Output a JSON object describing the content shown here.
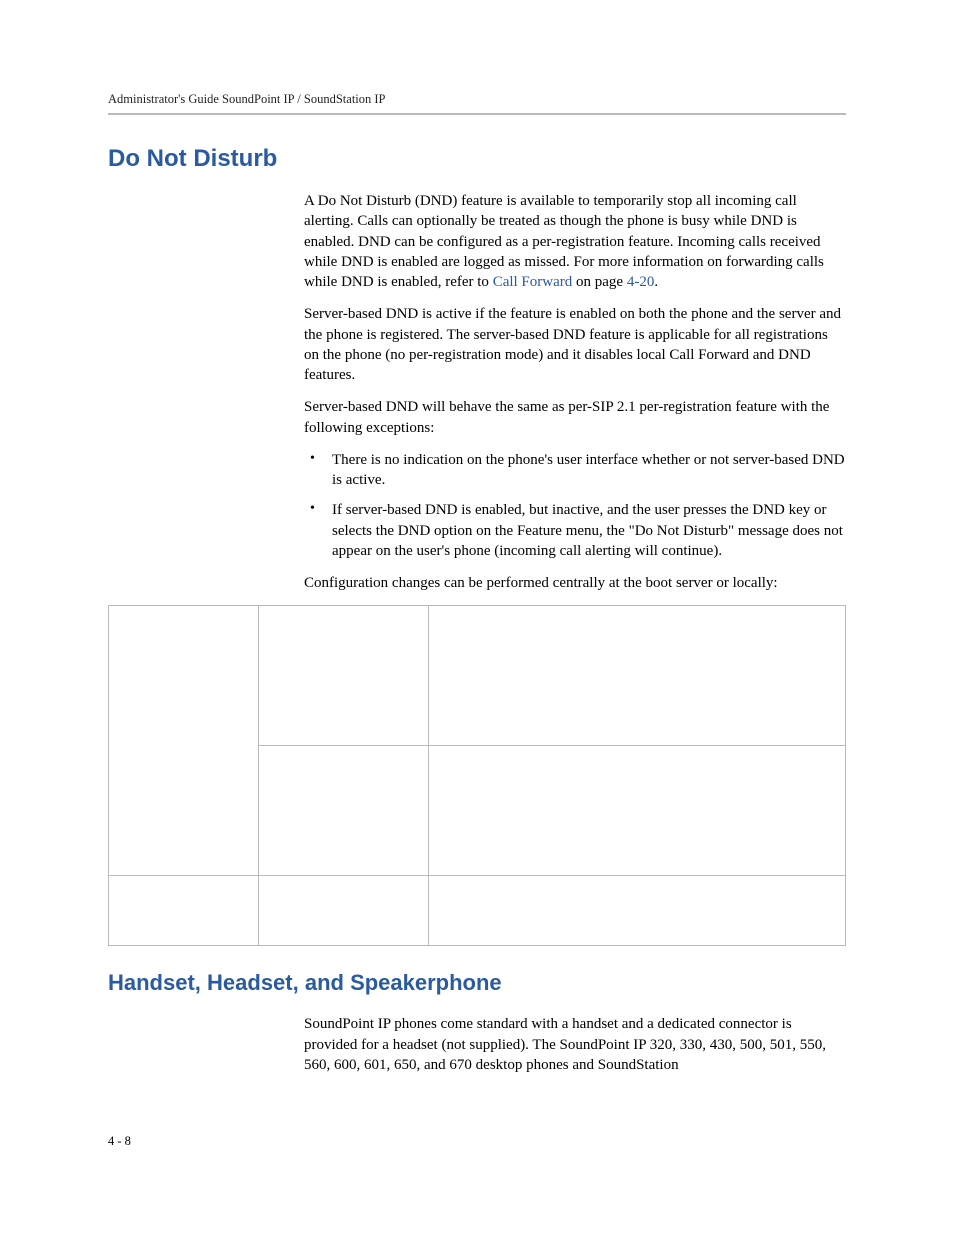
{
  "header": {
    "running_head": "Administrator's Guide SoundPoint IP / SoundStation IP"
  },
  "section1": {
    "title": "Do Not Disturb",
    "p1a": "A Do Not Disturb (DND) feature is available to temporarily stop all incoming call alerting. Calls can optionally be treated as though the phone is busy while DND is enabled. DND can be configured as a per-registration feature. Incoming calls received while DND is enabled are logged as missed. For more information on forwarding calls while DND is enabled, refer to ",
    "p1_link1": "Call Forward",
    "p1b": " on page ",
    "p1_link2": "4-20",
    "p1c": ".",
    "p2": "Server-based DND is active if the feature is enabled on both the phone and the server and the phone is registered. The server-based DND feature is applicable for all registrations on the phone (no per-registration mode) and it disables local Call Forward and DND features.",
    "p3": "Server-based DND will behave the same as per-SIP 2.1 per-registration feature with the following exceptions:",
    "bullets": [
      "There is no indication on the phone's user interface whether or not server-based DND is active.",
      "If server-based DND is enabled, but inactive, and the user presses the DND key or selects the DND option on the Feature menu, the \"Do Not Disturb\" message does not appear on the user's phone (incoming call alerting will continue)."
    ],
    "p4": "Configuration changes can be performed centrally at the boot server or locally:"
  },
  "table": {
    "rows": [
      {
        "c1": "",
        "c2": "",
        "c3": ""
      },
      {
        "c1": "",
        "c2": "",
        "c3": ""
      },
      {
        "c1": "",
        "c2": "",
        "c3": ""
      }
    ]
  },
  "section2": {
    "title": "Handset, Headset, and Speakerphone",
    "p1": "SoundPoint IP phones come standard with a handset and a dedicated connector is provided for a headset (not supplied). The SoundPoint IP 320, 330, 430, 500, 501, 550, 560, 600, 601, 650, and 670 desktop phones and SoundStation"
  },
  "footer": {
    "page_num": "4 - 8"
  }
}
